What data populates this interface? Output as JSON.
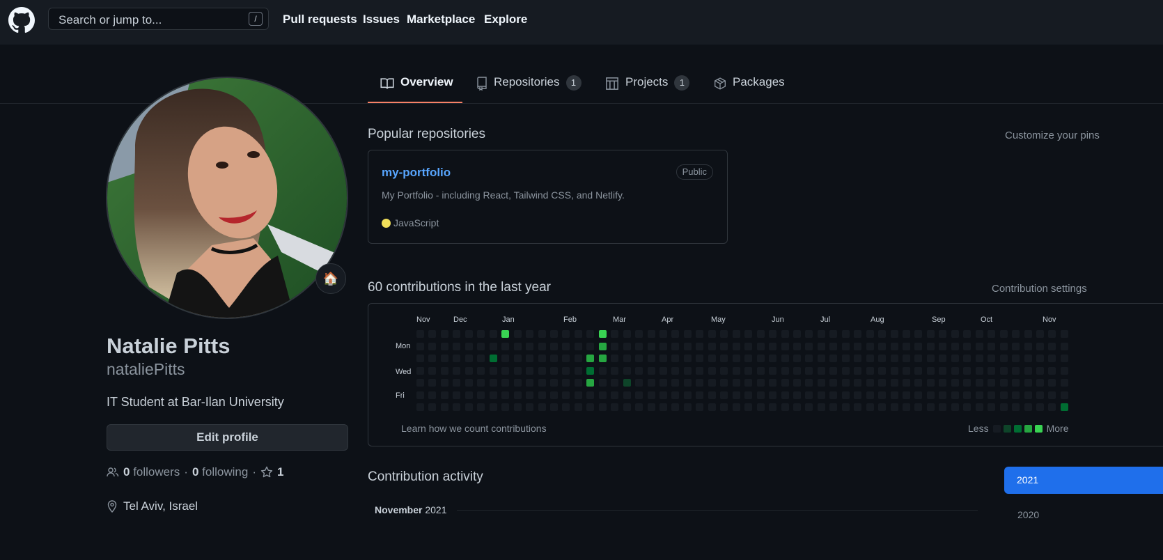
{
  "header": {
    "search_placeholder": "Search or jump to...",
    "search_shortcut": "/",
    "nav": [
      "Pull requests",
      "Issues",
      "Marketplace",
      "Explore"
    ]
  },
  "tabs": [
    {
      "label": "Overview",
      "icon": "book-icon",
      "active": true
    },
    {
      "label": "Repositories",
      "icon": "repo-icon",
      "count": "1"
    },
    {
      "label": "Projects",
      "icon": "project-icon",
      "count": "1"
    },
    {
      "label": "Packages",
      "icon": "package-icon"
    }
  ],
  "profile": {
    "status_emoji": "🏠",
    "full_name": "Natalie Pitts",
    "username": "nataliePitts",
    "bio": "IT Student at Bar-Ilan University",
    "edit_label": "Edit profile",
    "followers_count": "0",
    "followers_label": "followers",
    "following_count": "0",
    "following_label": "following",
    "stars_count": "1",
    "separator": "·",
    "location": "Tel Aviv, Israel"
  },
  "popular": {
    "title": "Popular repositories",
    "customize": "Customize your pins",
    "repo": {
      "name": "my-portfolio",
      "visibility": "Public",
      "description": "My Portfolio - including React, Tailwind CSS, and Netlify.",
      "language": "JavaScript",
      "language_color": "#f1e05a"
    }
  },
  "contributions": {
    "title": "60 contributions in the last year",
    "settings": "Contribution settings",
    "months": [
      "Nov",
      "Dec",
      "Jan",
      "Feb",
      "Mar",
      "Apr",
      "May",
      "Jun",
      "Jul",
      "Aug",
      "Sep",
      "Oct",
      "Nov"
    ],
    "days": [
      "Mon",
      "Wed",
      "Fri"
    ],
    "learn": "Learn how we count contributions",
    "less": "Less",
    "more": "More",
    "level_colors": [
      "#161b22",
      "#0e4429",
      "#006d32",
      "#26a641",
      "#39d353"
    ]
  },
  "activity": {
    "title": "Contribution activity",
    "month": "November",
    "year": "2021",
    "years": [
      "2021",
      "2020"
    ]
  }
}
